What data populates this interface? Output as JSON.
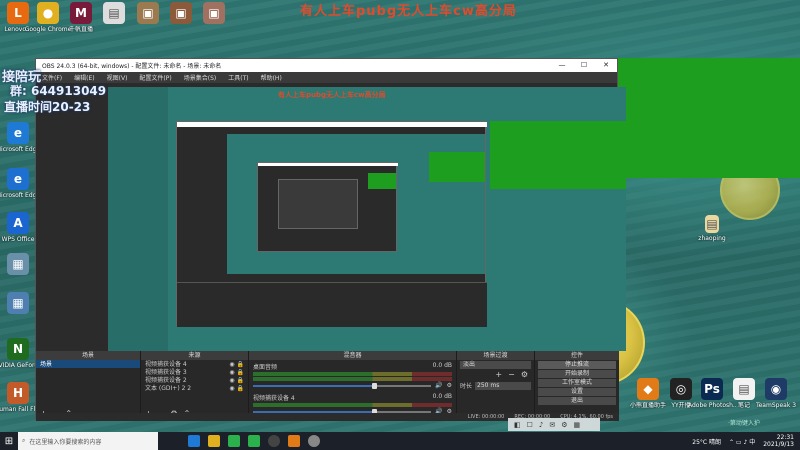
{
  "banner": "有人上车pubg无人上车cw高分局",
  "overlay": {
    "line1": "接陪玩",
    "line2": "群: 644913049",
    "line3": "直播时间20-23"
  },
  "desktop_icons_left": [
    {
      "label": "Lenovo...",
      "icon": "lenovo-icon",
      "color": "#e86a10",
      "char": "L"
    },
    {
      "label": "Microsoft Edge",
      "icon": "edge-icon",
      "color": "#1f7ad6",
      "char": "e"
    },
    {
      "label": "Microsoft Edge",
      "icon": "edge-icon",
      "color": "#1d6fd0",
      "char": "e"
    },
    {
      "label": "WPS Office",
      "icon": "wps-icon",
      "color": "#1b65d0",
      "char": "A"
    },
    {
      "label": "",
      "icon": "folder-icon",
      "color": "#6a8fa8",
      "char": "▦"
    },
    {
      "label": "",
      "icon": "folder-icon",
      "color": "#4f7fb0",
      "char": "▦"
    },
    {
      "label": "NVIDIA GeForce Experience",
      "icon": "nvidia-icon",
      "color": "#1f6b1f",
      "char": "N"
    },
    {
      "label": "Human Fall Flat",
      "icon": "game-icon",
      "color": "#c25a2a",
      "char": "H"
    }
  ],
  "desktop_icons_top": [
    {
      "label": "Google Chrome",
      "icon": "chrome-icon",
      "color": "#e0b020",
      "char": "●"
    },
    {
      "label": "千帆直播",
      "icon": "qianfan-icon",
      "color": "#7a1a3a",
      "char": "M"
    },
    {
      "label": "",
      "icon": "file-icon",
      "color": "#dddddd",
      "char": "▤"
    },
    {
      "label": "",
      "icon": "image-icon",
      "color": "#9b7a50",
      "char": "▣"
    },
    {
      "label": "",
      "icon": "image-icon",
      "color": "#8a5a3a",
      "char": "▣"
    },
    {
      "label": "",
      "icon": "image-icon",
      "color": "#a07060",
      "char": "▣"
    }
  ],
  "desktop_icons_right": [
    {
      "label": "小熊直播助手",
      "icon": "xiaoxiong-icon",
      "color": "#e07b18",
      "char": "◆"
    },
    {
      "label": "YY开播",
      "icon": "yy-icon",
      "color": "#222222",
      "char": "◎"
    },
    {
      "label": "Adobe Photosh...",
      "icon": "photoshop-icon",
      "color": "#0a2a52",
      "char": "Ps"
    },
    {
      "label": "笔记",
      "icon": "note-icon",
      "color": "#f2f2f2",
      "char": "▤"
    },
    {
      "label": "TeamSpeak 3",
      "icon": "teamspeak-icon",
      "color": "#1d3b66",
      "char": "◉"
    }
  ],
  "desktop_misc_icon": {
    "label": "zhaoping",
    "icon": "file-icon"
  },
  "obs": {
    "title": "OBS 24.0.3 (64-bit, windows) - 配置文件: 未命名 - 场景: 未命名",
    "menu": [
      "文件(F)",
      "编辑(E)",
      "视图(V)",
      "配置文件(P)",
      "场景集合(S)",
      "工具(T)",
      "帮助(H)"
    ],
    "docks": {
      "scenes_header": "场景",
      "scenes": [
        "场景"
      ],
      "sources_header": "来源",
      "sources": [
        "视频捕获设备 4",
        "视频捕获设备 3",
        "视频捕获设备 2",
        "文本 (GDI+) 2 2"
      ],
      "mixer_header": "混音器",
      "mixer": [
        {
          "name": "桌面音频",
          "db": "0.0 dB",
          "level": 0.68
        },
        {
          "name": "视频捕获设备 4",
          "db": "0.0 dB",
          "level": 0.68
        }
      ],
      "transitions_header": "场景过渡",
      "transition_value": "淡出",
      "duration_label": "时长",
      "duration_value": "250 ms",
      "controls_header": "控件",
      "controls": [
        "停止推流",
        "开始录制",
        "工作室模式",
        "设置",
        "退出"
      ]
    },
    "status": {
      "live": "LIVE: 00:00:00",
      "rec": "REC: 00:00:00",
      "cpu": "CPU: 4.1%, 60.00 fps"
    }
  },
  "taskbar": {
    "search_placeholder": "在这里输入你要搜索的内容",
    "weather": "25°C 晴朗",
    "time": "22:31",
    "date": "2021/9/13"
  },
  "watermark": "·第动键入护"
}
